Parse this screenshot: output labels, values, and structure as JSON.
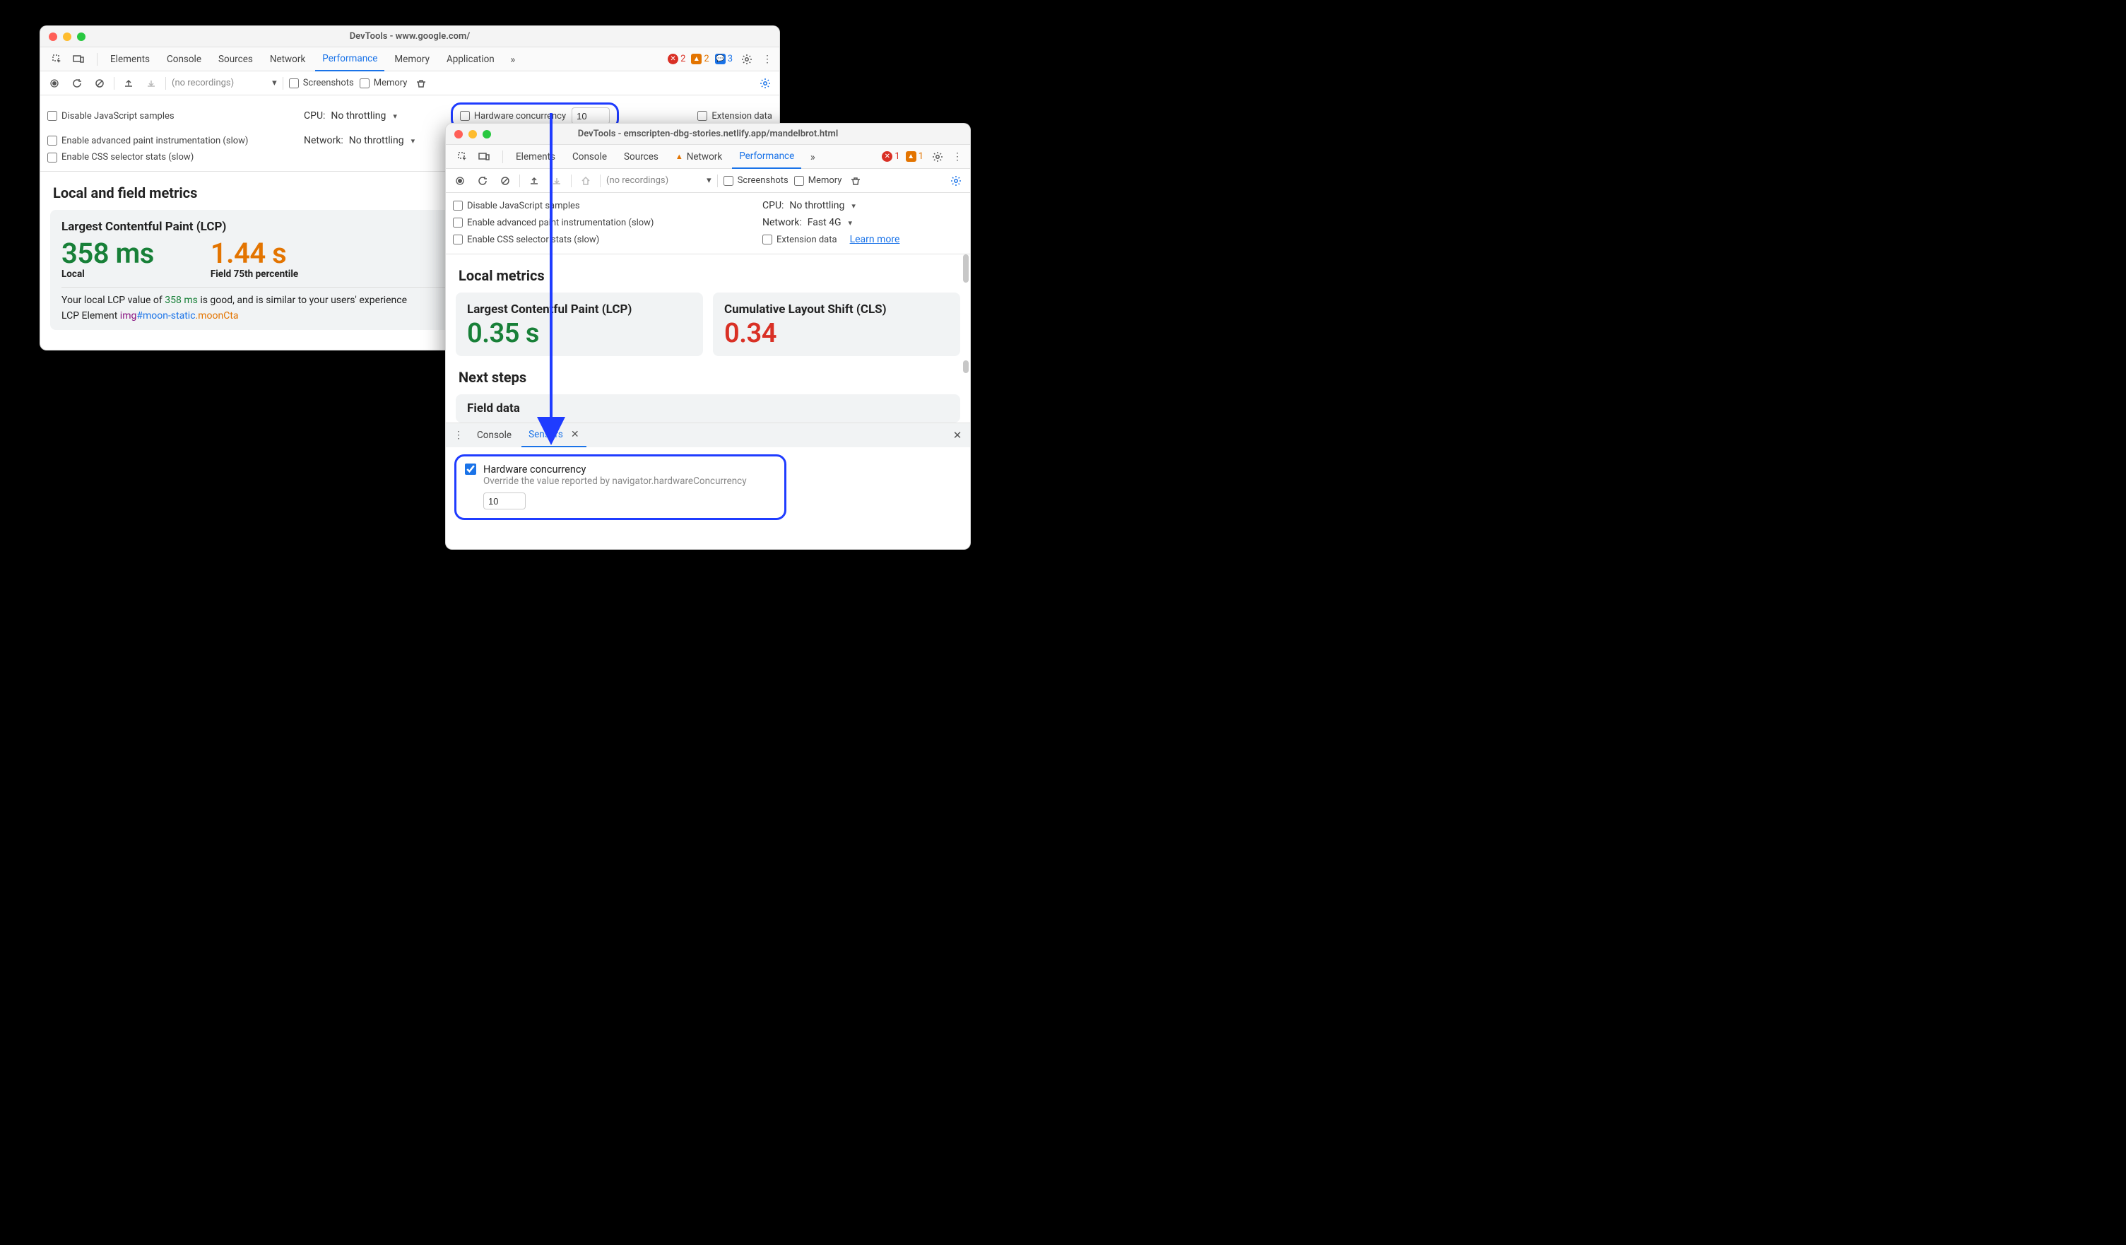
{
  "window1": {
    "title": "DevTools - www.google.com/",
    "tabs": [
      "Elements",
      "Console",
      "Sources",
      "Network",
      "Performance",
      "Memory",
      "Application"
    ],
    "active_tab": "Performance",
    "status": {
      "errors": "2",
      "warnings": "2",
      "info": "3"
    },
    "perfbar": {
      "recordings": "(no recordings)",
      "screenshots": "Screenshots",
      "memory": "Memory"
    },
    "settings": {
      "disable_js": "Disable JavaScript samples",
      "advanced_paint": "Enable advanced paint instrumentation (slow)",
      "css_stats": "Enable CSS selector stats (slow)",
      "cpu_label": "CPU:",
      "cpu_value": "No throttling",
      "net_label": "Network:",
      "net_value": "No throttling",
      "hw_label": "Hardware concurrency",
      "hw_value": "10",
      "ext_label": "Extension data"
    },
    "metrics": {
      "heading": "Local and field metrics",
      "lcp_title": "Largest Contentful Paint (LCP)",
      "local_val": "358 ms",
      "local_label": "Local",
      "field_val": "1.44 s",
      "field_label": "Field 75th percentile",
      "desc_pre": "Your local LCP value of ",
      "desc_val": "358 ms",
      "desc_post": " is good, and is similar to your users' experience",
      "lcp_el_label": "LCP Element ",
      "lcp_tag": "img",
      "lcp_id": "#moon-static",
      "lcp_class": ".moonCta"
    }
  },
  "window2": {
    "title": "DevTools - emscripten-dbg-stories.netlify.app/mandelbrot.html",
    "tabs": [
      "Elements",
      "Console",
      "Sources",
      "Network",
      "Performance"
    ],
    "active_tab": "Performance",
    "warn_tab": "Network",
    "status": {
      "errors": "1",
      "warnings": "1"
    },
    "perfbar": {
      "recordings": "(no recordings)",
      "screenshots": "Screenshots",
      "memory": "Memory"
    },
    "settings": {
      "disable_js": "Disable JavaScript samples",
      "advanced_paint": "Enable advanced paint instrumentation (slow)",
      "css_stats": "Enable CSS selector stats (slow)",
      "cpu_label": "CPU:",
      "cpu_value": "No throttling",
      "net_label": "Network:",
      "net_value": "Fast 4G",
      "ext_label": "Extension data",
      "learn_more": "Learn more"
    },
    "metrics": {
      "heading": "Local metrics",
      "lcp_title": "Largest Contentful Paint (LCP)",
      "lcp_val": "0.35 s",
      "cls_title": "Cumulative Layout Shift (CLS)",
      "cls_val": "0.34",
      "next_heading": "Next steps",
      "field_heading": "Field data"
    },
    "drawer": {
      "tabs": [
        "Console",
        "Sensors"
      ],
      "active": "Sensors",
      "hw_title": "Hardware concurrency",
      "hw_desc": "Override the value reported by navigator.hardwareConcurrency",
      "hw_value": "10"
    }
  }
}
